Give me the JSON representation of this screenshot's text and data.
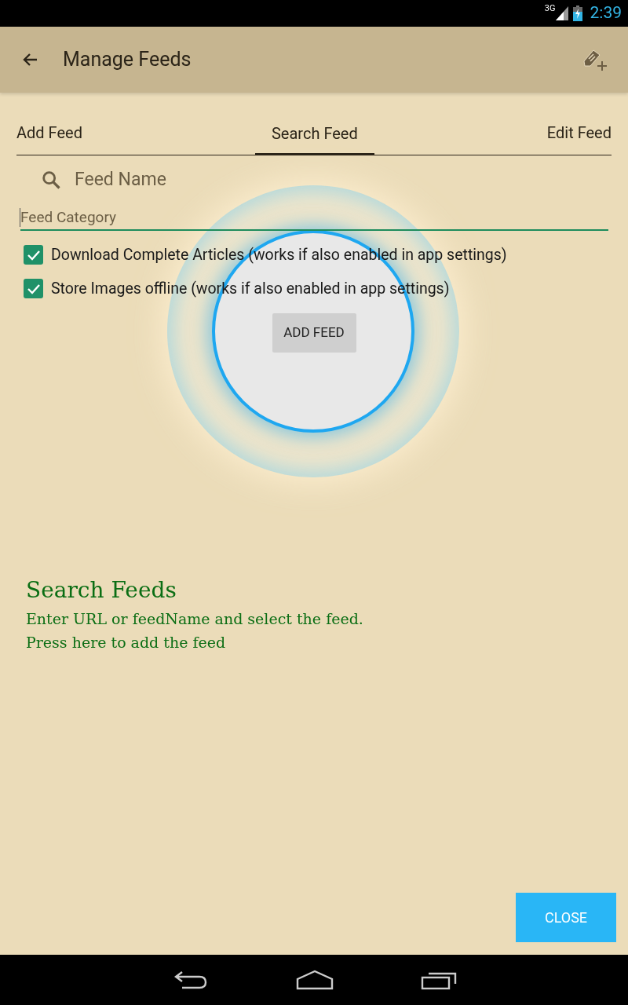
{
  "status_bar": {
    "network": "3G",
    "time": "2:39"
  },
  "app_bar": {
    "title": "Manage Feeds"
  },
  "tabs": [
    {
      "label": "Add Feed",
      "selected": false
    },
    {
      "label": "Search Feed",
      "selected": true
    },
    {
      "label": "Edit Feed",
      "selected": false
    }
  ],
  "search": {
    "placeholder": "Feed Name"
  },
  "category": {
    "placeholder": "Feed Category"
  },
  "options": [
    {
      "label": "Download Complete Articles (works if also enabled in app settings)",
      "checked": true
    },
    {
      "label": "Store Images offline (works if also enabled in app settings)",
      "checked": true
    }
  ],
  "showcase": {
    "button": "ADD FEED",
    "title": "Search Feeds",
    "lines": [
      "Enter URL or feedName and select the feed.",
      "Press here to add the feed"
    ]
  },
  "close_button": "CLOSE"
}
